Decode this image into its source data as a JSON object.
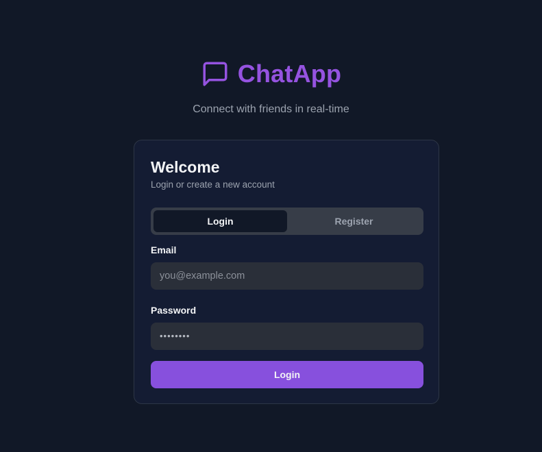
{
  "brand": {
    "name": "ChatApp",
    "tagline": "Connect with friends in real-time",
    "icon": "message-square-icon",
    "accent_color": "#9553e0"
  },
  "card": {
    "title": "Welcome",
    "subtitle": "Login or create a new account",
    "tabs": [
      {
        "label": "Login",
        "active": true
      },
      {
        "label": "Register",
        "active": false
      }
    ],
    "email": {
      "label": "Email",
      "placeholder": "you@example.com",
      "value": ""
    },
    "password": {
      "label": "Password",
      "value": "••••••••"
    },
    "submit_label": "Login",
    "submit_color": "#8750dd"
  }
}
